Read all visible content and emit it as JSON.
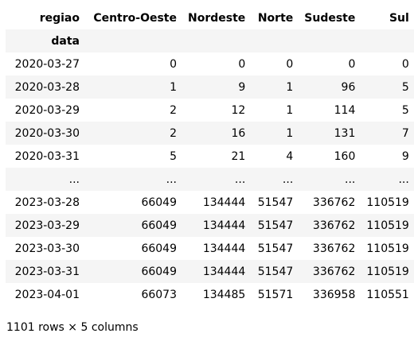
{
  "table": {
    "columns_name": "regiao",
    "index_name": "data",
    "columns": [
      "Centro-Oeste",
      "Nordeste",
      "Norte",
      "Sudeste",
      "Sul"
    ],
    "rows": [
      {
        "index": "2020-03-27",
        "values": [
          "0",
          "0",
          "0",
          "0",
          "0"
        ]
      },
      {
        "index": "2020-03-28",
        "values": [
          "1",
          "9",
          "1",
          "96",
          "5"
        ]
      },
      {
        "index": "2020-03-29",
        "values": [
          "2",
          "12",
          "1",
          "114",
          "5"
        ]
      },
      {
        "index": "2020-03-30",
        "values": [
          "2",
          "16",
          "1",
          "131",
          "7"
        ]
      },
      {
        "index": "2020-03-31",
        "values": [
          "5",
          "21",
          "4",
          "160",
          "9"
        ]
      },
      {
        "index": "...",
        "values": [
          "...",
          "...",
          "...",
          "...",
          "..."
        ]
      },
      {
        "index": "2023-03-28",
        "values": [
          "66049",
          "134444",
          "51547",
          "336762",
          "110519"
        ]
      },
      {
        "index": "2023-03-29",
        "values": [
          "66049",
          "134444",
          "51547",
          "336762",
          "110519"
        ]
      },
      {
        "index": "2023-03-30",
        "values": [
          "66049",
          "134444",
          "51547",
          "336762",
          "110519"
        ]
      },
      {
        "index": "2023-03-31",
        "values": [
          "66049",
          "134444",
          "51547",
          "336762",
          "110519"
        ]
      },
      {
        "index": "2023-04-01",
        "values": [
          "66073",
          "134485",
          "51571",
          "336958",
          "110551"
        ]
      }
    ]
  },
  "footer": "1101 rows × 5 columns"
}
